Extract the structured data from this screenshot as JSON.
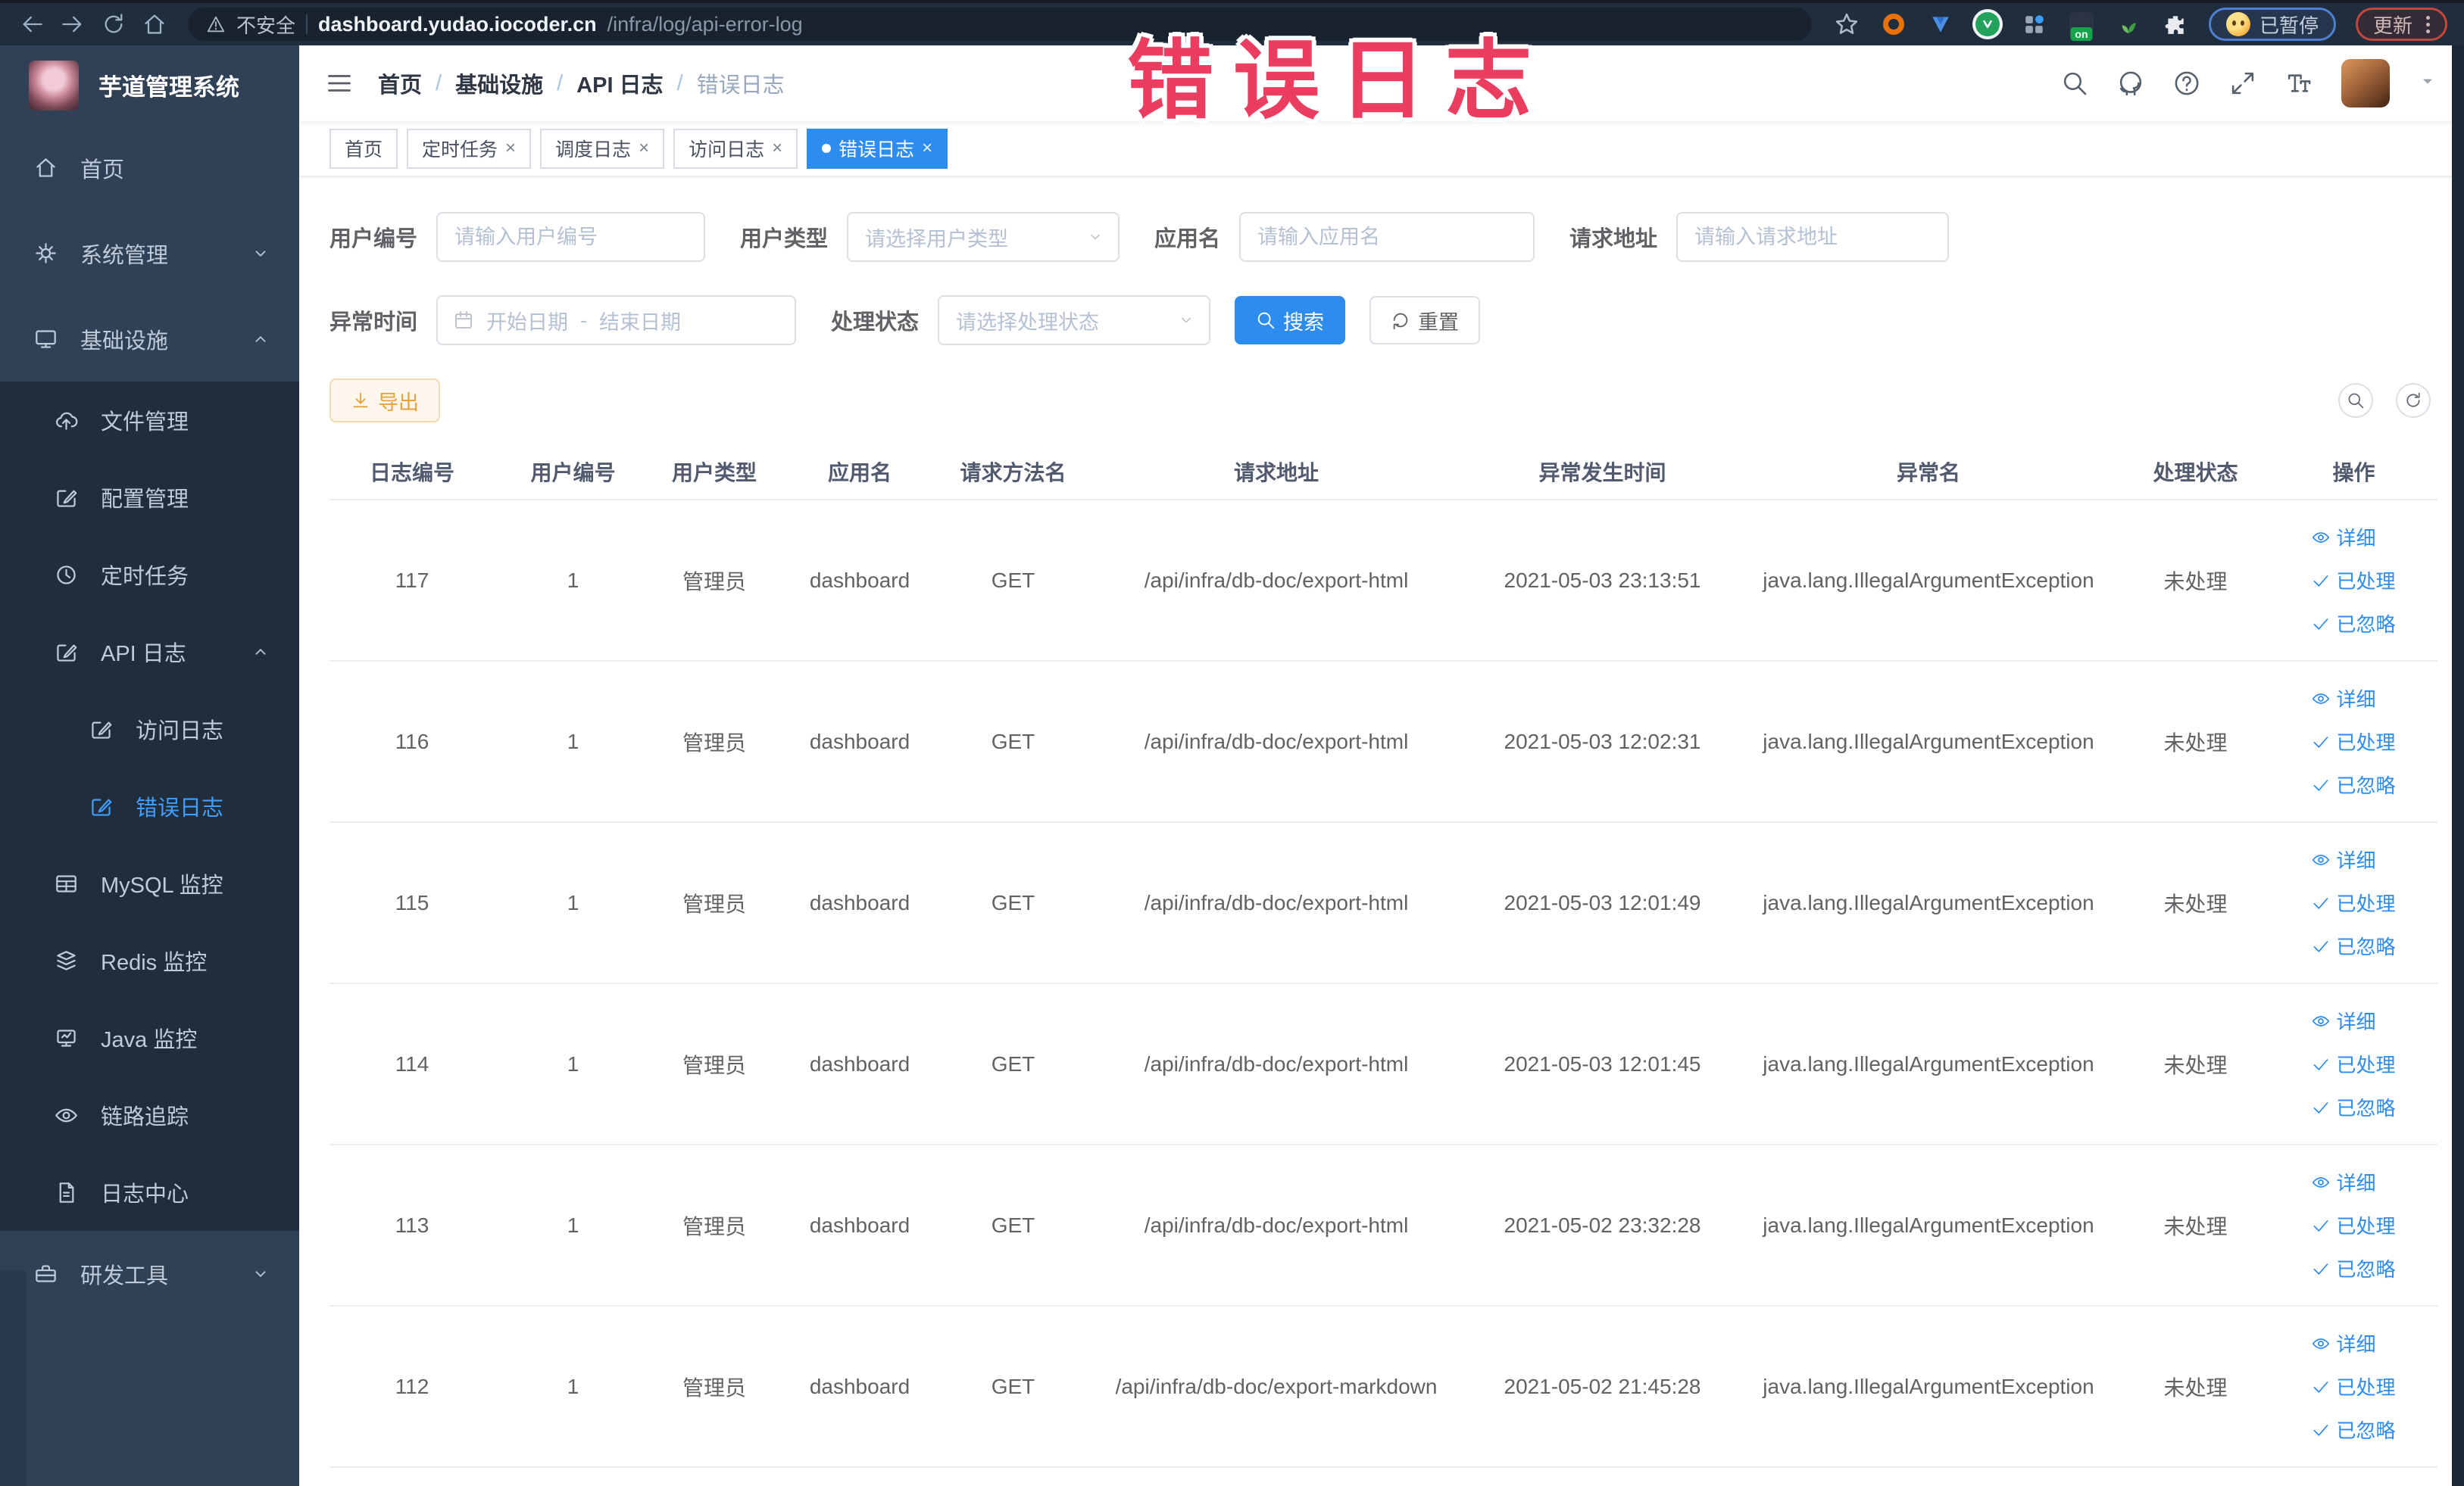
{
  "colors": {
    "accent": "#2d8cf0",
    "sidebar_bg": "#304156",
    "submenu_bg": "#1f2d3d",
    "warning": "#e6a23c",
    "overlay_text": "#ea3d5f"
  },
  "ui": {
    "breadcrumb_separator": "/",
    "close_glyph": "×",
    "extension_on_badge": "on"
  },
  "overlay": {
    "text": "错误日志"
  },
  "browser": {
    "security_label": "不安全",
    "url_host": "dashboard.yudao.iocoder.cn",
    "url_path": "/infra/log/api-error-log",
    "paused_pill": "已暂停",
    "update_pill": "更新"
  },
  "sidebar": {
    "title": "芋道管理系统",
    "items": [
      {
        "label": "首页"
      },
      {
        "label": "系统管理"
      },
      {
        "label": "基础设施"
      },
      {
        "label": "文件管理"
      },
      {
        "label": "配置管理"
      },
      {
        "label": "定时任务"
      },
      {
        "label": "API 日志"
      },
      {
        "label": "访问日志"
      },
      {
        "label": "错误日志"
      },
      {
        "label": "MySQL 监控"
      },
      {
        "label": "Redis 监控"
      },
      {
        "label": "Java 监控"
      },
      {
        "label": "链路追踪"
      },
      {
        "label": "日志中心"
      },
      {
        "label": "研发工具"
      }
    ]
  },
  "breadcrumb": [
    "首页",
    "基础设施",
    "API 日志",
    "错误日志"
  ],
  "tabs": [
    {
      "label": "首页"
    },
    {
      "label": "定时任务"
    },
    {
      "label": "调度日志"
    },
    {
      "label": "访问日志"
    },
    {
      "label": "错误日志"
    }
  ],
  "filters": {
    "user_id": {
      "label": "用户编号",
      "placeholder": "请输入用户编号"
    },
    "user_type": {
      "label": "用户类型",
      "placeholder": "请选择用户类型"
    },
    "app_name": {
      "label": "应用名",
      "placeholder": "请输入应用名"
    },
    "request_url": {
      "label": "请求地址",
      "placeholder": "请输入请求地址"
    },
    "exception_time": {
      "label": "异常时间",
      "start_placeholder": "开始日期",
      "separator": "-",
      "end_placeholder": "结束日期"
    },
    "process_status": {
      "label": "处理状态",
      "placeholder": "请选择处理状态"
    },
    "search_button": "搜索",
    "reset_button": "重置"
  },
  "toolbar": {
    "export_button": "导出"
  },
  "table": {
    "columns": [
      "日志编号",
      "用户编号",
      "用户类型",
      "应用名",
      "请求方法名",
      "请求地址",
      "异常发生时间",
      "异常名",
      "处理状态",
      "操作"
    ],
    "actions": {
      "detail": "详细",
      "processed": "已处理",
      "ignored": "已忽略"
    },
    "rows": [
      {
        "id": "117",
        "user_id": "1",
        "user_type": "管理员",
        "app": "dashboard",
        "method": "GET",
        "url": "/api/infra/db-doc/export-html",
        "time": "2021-05-03 23:13:51",
        "exception": "java.lang.IllegalArgumentException",
        "status": "未处理"
      },
      {
        "id": "116",
        "user_id": "1",
        "user_type": "管理员",
        "app": "dashboard",
        "method": "GET",
        "url": "/api/infra/db-doc/export-html",
        "time": "2021-05-03 12:02:31",
        "exception": "java.lang.IllegalArgumentException",
        "status": "未处理"
      },
      {
        "id": "115",
        "user_id": "1",
        "user_type": "管理员",
        "app": "dashboard",
        "method": "GET",
        "url": "/api/infra/db-doc/export-html",
        "time": "2021-05-03 12:01:49",
        "exception": "java.lang.IllegalArgumentException",
        "status": "未处理"
      },
      {
        "id": "114",
        "user_id": "1",
        "user_type": "管理员",
        "app": "dashboard",
        "method": "GET",
        "url": "/api/infra/db-doc/export-html",
        "time": "2021-05-03 12:01:45",
        "exception": "java.lang.IllegalArgumentException",
        "status": "未处理"
      },
      {
        "id": "113",
        "user_id": "1",
        "user_type": "管理员",
        "app": "dashboard",
        "method": "GET",
        "url": "/api/infra/db-doc/export-html",
        "time": "2021-05-02 23:32:28",
        "exception": "java.lang.IllegalArgumentException",
        "status": "未处理"
      },
      {
        "id": "112",
        "user_id": "1",
        "user_type": "管理员",
        "app": "dashboard",
        "method": "GET",
        "url": "/api/infra/db-doc/export-markdown",
        "time": "2021-05-02 21:45:28",
        "exception": "java.lang.IllegalArgumentException",
        "status": "未处理"
      }
    ]
  }
}
